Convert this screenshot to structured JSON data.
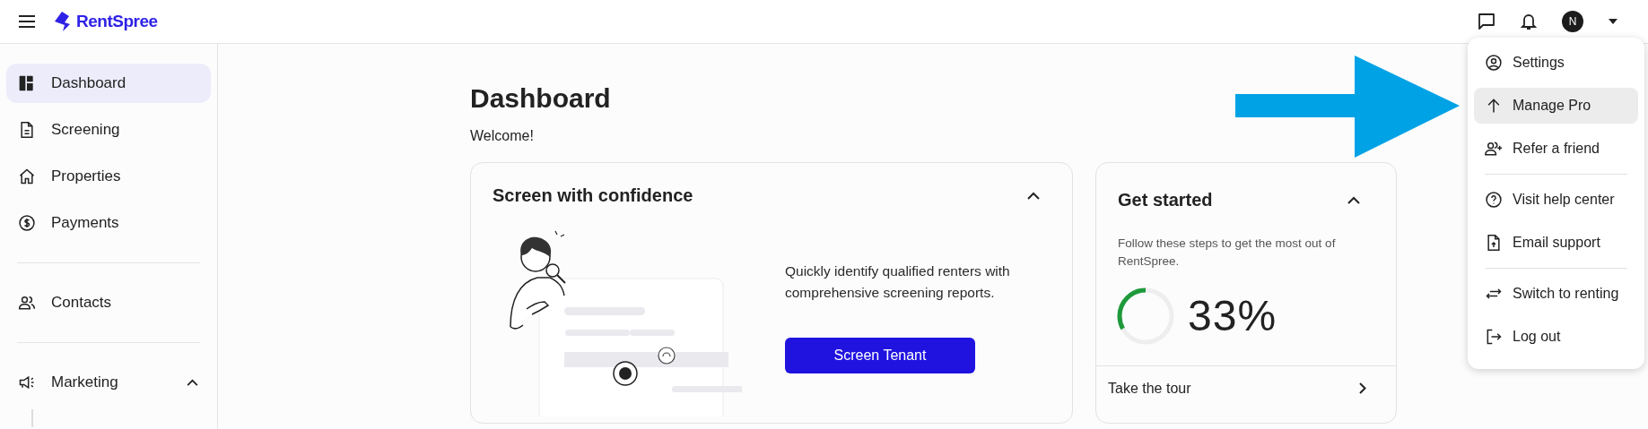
{
  "header": {
    "logo": "RentSpree",
    "avatar_initial": "N"
  },
  "sidebar": {
    "groups": [
      [
        {
          "label": "Dashboard",
          "selected": true
        },
        {
          "label": "Screening",
          "selected": false
        },
        {
          "label": "Properties",
          "selected": false
        },
        {
          "label": "Payments",
          "selected": false
        }
      ],
      [
        {
          "label": "Contacts",
          "selected": false
        }
      ],
      [
        {
          "label": "Marketing",
          "selected": false,
          "expanded": true
        }
      ]
    ]
  },
  "page": {
    "title": "Dashboard",
    "subtitle": "Welcome!"
  },
  "screen_card": {
    "title": "Screen with confidence",
    "expanded": true,
    "text": "Quickly identify qualified renters with comprehensive screening reports.",
    "button": "Screen Tenant"
  },
  "get_started_card": {
    "title": "Get started",
    "expanded": true,
    "text": "Follow these steps to get the most out of RentSpree.",
    "progress": {
      "level": 0.33,
      "reading": "33%"
    },
    "link": "Take the tour"
  },
  "account_menu": {
    "groups": [
      [
        {
          "label": "Settings",
          "selected": false
        },
        {
          "label": "Manage Pro",
          "selected": true
        },
        {
          "label": "Refer a friend",
          "selected": false
        }
      ],
      [
        {
          "label": "Visit help center",
          "selected": false
        },
        {
          "label": "Email support",
          "selected": false
        }
      ],
      [
        {
          "label": "Switch to renting",
          "selected": false
        },
        {
          "label": "Log out",
          "selected": false
        }
      ]
    ]
  }
}
